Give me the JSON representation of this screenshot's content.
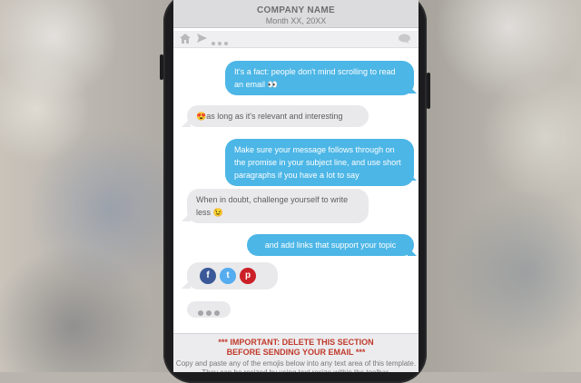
{
  "header": {
    "company": "COMPANY NAME",
    "date": "Month XX, 20XX"
  },
  "toolbar": {
    "icons": [
      "home-icon",
      "send-icon",
      "more-dots-icon",
      "chat-bubble-icon"
    ]
  },
  "messages": [
    {
      "side": "out",
      "text": "It's a fact: people don't mind scrolling to read an email",
      "emoji": "👀"
    },
    {
      "side": "in",
      "emoji": "😍",
      "text": "as long as it's relevant and interesting"
    },
    {
      "side": "out",
      "text": "Make sure your message follows through on the promise in your subject line, and use short paragraphs if you have a lot to say"
    },
    {
      "side": "in",
      "text": "When in doubt, challenge yourself to write less",
      "emoji": "😉"
    },
    {
      "side": "out",
      "text": "and add links that support your topic"
    }
  ],
  "social": {
    "facebook": "f",
    "twitter": "t",
    "pinterest": "p",
    "colors": {
      "facebook": "#3b5998",
      "twitter": "#55acee",
      "pinterest": "#cb2027"
    }
  },
  "footer": {
    "warning_line1": "*** IMPORTANT: DELETE THIS SECTION",
    "warning_line2": "BEFORE SENDING YOUR EMAIL ***",
    "note": "Copy and paste any of the emojis below into any text area of this template. They can be resized by using text resize within the toolbar."
  },
  "colors": {
    "outgoing": "#4cb6e6",
    "incoming": "#e9e9eb",
    "warning": "#c0392b"
  }
}
